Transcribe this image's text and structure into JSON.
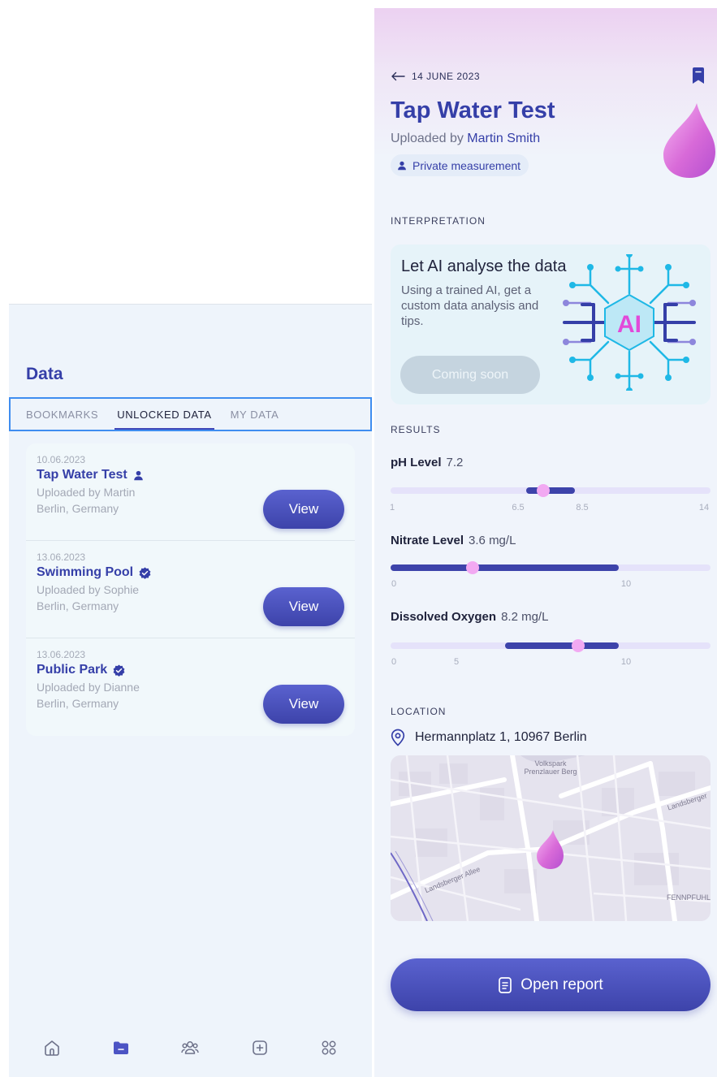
{
  "left_screen": {
    "title": "Data",
    "tabs": [
      {
        "label": "BOOKMARKS",
        "active": false
      },
      {
        "label": "UNLOCKED DATA",
        "active": true
      },
      {
        "label": "MY DATA",
        "active": false
      }
    ],
    "items": [
      {
        "date": "10.06.2023",
        "name": "Tap Water Test",
        "badge_icon": "person-icon",
        "uploaded_by": "Uploaded by Martin",
        "location": "Berlin, Germany",
        "action": "View"
      },
      {
        "date": "13.06.2023",
        "name": "Swimming Pool",
        "badge_icon": "verified-icon",
        "uploaded_by": "Uploaded by Sophie",
        "location": "Berlin, Germany",
        "action": "View"
      },
      {
        "date": "13.06.2023",
        "name": "Public Park",
        "badge_icon": "verified-icon",
        "uploaded_by": "Uploaded by Dianne",
        "location": "Berlin, Germany",
        "action": "View"
      }
    ],
    "bottom_nav": [
      "home-icon",
      "folder-icon",
      "community-icon",
      "add-icon",
      "apps-icon"
    ],
    "active_nav": "folder-icon"
  },
  "right_screen": {
    "date": "14 JUNE 2023",
    "title": "Tap Water Test",
    "uploaded_prefix": "Uploaded by",
    "uploaded_name": "Martin Smith",
    "privacy": "Private measurement",
    "interpretation_label": "INTERPRETATION",
    "ai_card": {
      "title": "Let AI analyse the data",
      "text": "Using a trained AI, get a custom data analysis and tips.",
      "button": "Coming soon",
      "art_text": "AI"
    },
    "results_label": "RESULTS",
    "results": [
      {
        "name": "pH Level",
        "value": "7.2",
        "min": 1,
        "max": 14,
        "range": [
          6.5,
          8.5
        ],
        "reading": 7.2,
        "ticks": [
          "1",
          "6.5",
          "8.5",
          "14"
        ]
      },
      {
        "name": "Nitrate Level",
        "value": "3.6 mg/L",
        "min": 0,
        "max": 14,
        "range": [
          0,
          10
        ],
        "reading": 3.6,
        "ticks": [
          "0",
          "10"
        ]
      },
      {
        "name": "Dissolved Oxygen",
        "value": "8.2 mg/L",
        "min": 0,
        "max": 14,
        "range": [
          5,
          10
        ],
        "reading": 8.2,
        "ticks": [
          "0",
          "5",
          "10"
        ]
      }
    ],
    "location_label": "LOCATION",
    "address": "Hermannplatz 1, 10967 Berlin",
    "map_labels": [
      "Volkspark Prenzlauer Berg",
      "Landsberger Allee",
      "FENNPFUHL",
      "Landsberger"
    ],
    "report_button": "Open report",
    "colors": {
      "primary": "#3d43aa",
      "accent": "#f2a9f2",
      "drop": "#d86ad8"
    }
  }
}
